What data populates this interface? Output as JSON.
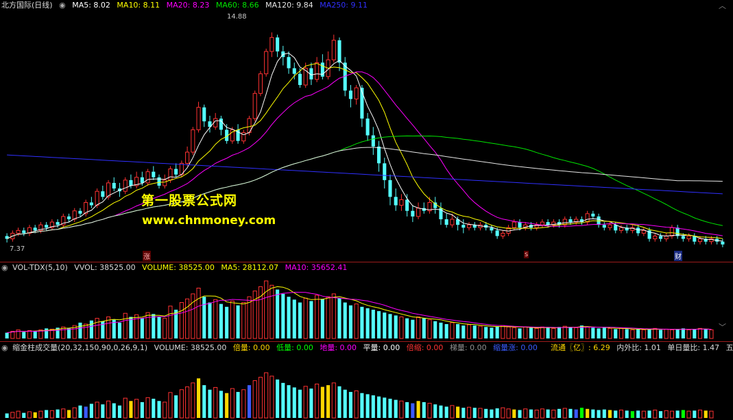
{
  "main_legend": {
    "stock_name": "北方国际(日线)",
    "ma5": "MA5: 8.02",
    "ma10": "MA10: 8.11",
    "ma20": "MA20: 8.23",
    "ma60": "MA60: 8.66",
    "ma120": "MA120: 9.84",
    "ma250": "MA250: 9.11"
  },
  "vol_legend": {
    "name": "VOL-TDX(5,10)",
    "vvol": "VVOL: 38525.00",
    "volume": "VOLUME: 38525.00",
    "ma5": "MA5: 28112.07",
    "ma10": "MA10: 35652.41"
  },
  "third_legend": {
    "name": "缩金柱成交量(20,32,150,90,0,26,9,1)",
    "volume": "VOLUME: 38525.00",
    "bei": "倍量: 0.00",
    "di": "低量: 0.00",
    "di2": "地量: 0.00",
    "ping": "平量: 0.00",
    "beisuo": "倍缩: 0.00",
    "ti": "梯量: 0.00",
    "suo": "缩量涨: 0.00",
    "liutong": "流通〖亿〗: 6.29",
    "neiwai": "内外比: 1.01",
    "danri": "单日量比: 1.47",
    "wu": "五日"
  },
  "price_labels": {
    "high": "14.88",
    "low": "7.37"
  },
  "events": {
    "zhang": "涨",
    "s": "s",
    "cai": "财"
  },
  "watermark": {
    "line1": "第一股票公式网",
    "line2": "www.chnmoney.com"
  },
  "colors": {
    "up": "#ff3232",
    "down": "#54fcfc",
    "ma5": "#ffffff",
    "ma10": "#ffff00",
    "ma20": "#ff00ff",
    "ma60": "#00e600",
    "ma120": "#e6e6e6",
    "ma250": "#3030ff",
    "gold": "#ffd700",
    "green": "#00ff00",
    "blue": "#3a5bff"
  },
  "chart_data": {
    "type": "candlestick",
    "title": "北方国际(日线)",
    "ylim": [
      7.0,
      15.5
    ],
    "high": 14.88,
    "low": 7.37,
    "candles": [
      [
        7.6,
        7.5,
        7.7,
        7.37
      ],
      [
        7.5,
        7.7,
        7.8,
        7.4
      ],
      [
        7.7,
        7.8,
        7.9,
        7.6
      ],
      [
        7.8,
        7.7,
        7.9,
        7.6
      ],
      [
        7.7,
        7.9,
        8.0,
        7.6
      ],
      [
        7.9,
        7.8,
        8.0,
        7.7
      ],
      [
        7.8,
        8.0,
        8.1,
        7.7
      ],
      [
        8.0,
        7.9,
        8.1,
        7.8
      ],
      [
        7.9,
        8.1,
        8.2,
        7.8
      ],
      [
        8.1,
        8.0,
        8.2,
        7.9
      ],
      [
        8.0,
        8.3,
        8.4,
        7.9
      ],
      [
        8.3,
        8.2,
        8.4,
        8.1
      ],
      [
        8.2,
        8.5,
        8.6,
        8.1
      ],
      [
        8.5,
        8.4,
        8.6,
        8.3
      ],
      [
        8.4,
        8.8,
        8.9,
        8.3
      ],
      [
        8.8,
        8.7,
        9.0,
        8.6
      ],
      [
        8.7,
        9.2,
        9.3,
        8.6
      ],
      [
        9.2,
        9.0,
        9.4,
        8.9
      ],
      [
        9.0,
        9.5,
        9.6,
        8.9
      ],
      [
        9.5,
        9.3,
        9.7,
        9.2
      ],
      [
        9.3,
        9.2,
        9.5,
        9.0
      ],
      [
        9.2,
        9.6,
        9.7,
        9.1
      ],
      [
        9.6,
        9.4,
        9.8,
        9.3
      ],
      [
        9.4,
        9.7,
        9.9,
        9.3
      ],
      [
        9.7,
        9.5,
        9.9,
        9.4
      ],
      [
        9.5,
        9.9,
        10.0,
        9.4
      ],
      [
        9.9,
        9.7,
        10.1,
        9.6
      ],
      [
        9.7,
        9.4,
        9.8,
        9.3
      ],
      [
        9.4,
        9.6,
        9.8,
        9.3
      ],
      [
        9.6,
        10.0,
        10.1,
        9.5
      ],
      [
        10.0,
        9.8,
        10.2,
        9.7
      ],
      [
        9.8,
        10.2,
        10.3,
        9.7
      ],
      [
        10.2,
        10.6,
        10.8,
        10.1
      ],
      [
        10.6,
        11.4,
        11.5,
        10.5
      ],
      [
        11.4,
        12.2,
        12.4,
        11.3
      ],
      [
        12.2,
        11.7,
        12.3,
        11.5
      ],
      [
        11.7,
        11.5,
        11.9,
        11.3
      ],
      [
        11.5,
        11.8,
        12.0,
        11.4
      ],
      [
        11.8,
        11.4,
        11.9,
        11.2
      ],
      [
        11.4,
        11.0,
        11.6,
        10.9
      ],
      [
        11.0,
        11.4,
        11.5,
        10.9
      ],
      [
        11.4,
        11.0,
        11.6,
        10.9
      ],
      [
        11.0,
        11.3,
        11.4,
        10.9
      ],
      [
        11.3,
        11.8,
        11.9,
        11.2
      ],
      [
        11.8,
        12.7,
        12.8,
        11.7
      ],
      [
        12.7,
        13.4,
        13.5,
        12.6
      ],
      [
        13.4,
        14.2,
        14.3,
        13.3
      ],
      [
        14.2,
        14.7,
        14.88,
        14.0
      ],
      [
        14.7,
        14.2,
        14.8,
        14.0
      ],
      [
        14.2,
        14.0,
        14.4,
        13.7
      ],
      [
        14.0,
        13.6,
        14.2,
        13.4
      ],
      [
        13.6,
        13.4,
        13.8,
        13.2
      ],
      [
        13.4,
        13.0,
        13.6,
        12.9
      ],
      [
        13.0,
        13.6,
        13.8,
        12.9
      ],
      [
        13.6,
        13.2,
        13.8,
        13.0
      ],
      [
        13.2,
        13.8,
        14.0,
        13.1
      ],
      [
        13.8,
        13.3,
        14.1,
        13.2
      ],
      [
        13.3,
        13.9,
        14.2,
        13.2
      ],
      [
        13.9,
        14.6,
        14.8,
        13.8
      ],
      [
        14.6,
        13.8,
        14.7,
        13.5
      ],
      [
        13.8,
        12.8,
        14.0,
        12.6
      ],
      [
        12.8,
        12.5,
        13.0,
        12.2
      ],
      [
        12.5,
        12.9,
        13.0,
        12.3
      ],
      [
        12.9,
        11.8,
        13.0,
        11.5
      ],
      [
        11.8,
        11.2,
        12.0,
        11.0
      ],
      [
        11.2,
        10.8,
        11.5,
        10.5
      ],
      [
        10.8,
        10.2,
        11.0,
        9.9
      ],
      [
        10.2,
        9.6,
        10.4,
        9.3
      ],
      [
        9.6,
        9.0,
        9.8,
        8.7
      ],
      [
        9.0,
        8.7,
        9.3,
        8.5
      ],
      [
        8.7,
        8.9,
        9.1,
        8.5
      ],
      [
        8.9,
        8.5,
        9.1,
        8.3
      ],
      [
        8.5,
        8.3,
        8.7,
        8.1
      ],
      [
        8.3,
        8.6,
        8.8,
        8.2
      ],
      [
        8.6,
        8.5,
        8.8,
        8.4
      ],
      [
        8.5,
        8.8,
        9.0,
        8.4
      ],
      [
        8.8,
        8.6,
        9.0,
        8.4
      ],
      [
        8.6,
        8.2,
        8.8,
        8.0
      ],
      [
        8.2,
        8.0,
        8.4,
        7.9
      ],
      [
        8.0,
        8.2,
        8.4,
        7.9
      ],
      [
        8.2,
        8.0,
        8.3,
        7.8
      ],
      [
        8.0,
        7.9,
        8.2,
        7.7
      ],
      [
        7.9,
        8.0,
        8.1,
        7.8
      ],
      [
        8.0,
        7.9,
        8.1,
        7.8
      ],
      [
        7.9,
        8.0,
        8.1,
        7.8
      ],
      [
        8.0,
        7.9,
        8.1,
        7.8
      ],
      [
        7.9,
        7.8,
        8.0,
        7.7
      ],
      [
        7.8,
        7.6,
        7.9,
        7.5
      ],
      [
        7.6,
        7.7,
        7.8,
        7.5
      ],
      [
        7.7,
        7.9,
        8.0,
        7.6
      ],
      [
        7.9,
        8.1,
        8.2,
        7.8
      ],
      [
        8.1,
        7.9,
        8.2,
        7.8
      ],
      [
        7.9,
        8.0,
        8.1,
        7.8
      ],
      [
        8.0,
        7.9,
        8.1,
        7.8
      ],
      [
        7.9,
        8.0,
        8.1,
        7.8
      ],
      [
        8.0,
        8.1,
        8.2,
        7.9
      ],
      [
        8.1,
        8.0,
        8.2,
        7.9
      ],
      [
        8.0,
        8.1,
        8.2,
        7.9
      ],
      [
        8.1,
        8.0,
        8.2,
        7.9
      ],
      [
        8.0,
        8.2,
        8.3,
        7.9
      ],
      [
        8.2,
        8.1,
        8.3,
        8.0
      ],
      [
        8.1,
        8.2,
        8.3,
        8.0
      ],
      [
        8.2,
        8.1,
        8.3,
        8.0
      ],
      [
        8.1,
        8.4,
        8.5,
        8.0
      ],
      [
        8.4,
        8.3,
        8.5,
        8.2
      ],
      [
        8.3,
        8.0,
        8.4,
        7.9
      ],
      [
        8.0,
        7.9,
        8.1,
        7.8
      ],
      [
        7.9,
        8.0,
        8.1,
        7.8
      ],
      [
        8.0,
        7.8,
        8.1,
        7.7
      ],
      [
        7.8,
        7.9,
        8.0,
        7.7
      ],
      [
        7.9,
        7.8,
        8.0,
        7.7
      ],
      [
        7.8,
        7.9,
        8.0,
        7.7
      ],
      [
        7.9,
        7.7,
        8.0,
        7.6
      ],
      [
        7.7,
        7.8,
        7.9,
        7.6
      ],
      [
        7.8,
        7.5,
        7.9,
        7.4
      ],
      [
        7.5,
        7.6,
        7.7,
        7.4
      ],
      [
        7.6,
        7.5,
        7.7,
        7.4
      ],
      [
        7.5,
        7.6,
        7.7,
        7.4
      ],
      [
        7.6,
        7.9,
        8.0,
        7.5
      ],
      [
        7.9,
        7.6,
        8.0,
        7.5
      ],
      [
        7.6,
        7.5,
        7.7,
        7.4
      ],
      [
        7.5,
        7.6,
        7.7,
        7.4
      ],
      [
        7.6,
        7.4,
        7.7,
        7.3
      ],
      [
        7.4,
        7.5,
        7.6,
        7.3
      ],
      [
        7.5,
        7.4,
        7.6,
        7.3
      ],
      [
        7.4,
        7.5,
        7.6,
        7.3
      ],
      [
        7.5,
        7.4,
        7.6,
        7.3
      ],
      [
        7.4,
        7.3,
        7.5,
        7.2
      ]
    ],
    "volume": [
      8,
      10,
      12,
      9,
      11,
      10,
      12,
      14,
      13,
      15,
      16,
      14,
      18,
      22,
      20,
      25,
      28,
      24,
      30,
      26,
      22,
      35,
      30,
      33,
      28,
      36,
      34,
      30,
      28,
      45,
      40,
      50,
      55,
      62,
      70,
      58,
      50,
      54,
      48,
      44,
      52,
      46,
      50,
      58,
      66,
      72,
      80,
      74,
      68,
      62,
      58,
      54,
      50,
      56,
      52,
      60,
      55,
      58,
      62,
      56,
      50,
      46,
      48,
      44,
      42,
      40,
      38,
      36,
      34,
      32,
      30,
      28,
      26,
      30,
      28,
      26,
      24,
      22,
      20,
      22,
      20,
      18,
      19,
      18,
      17,
      16,
      15,
      17,
      18,
      16,
      15,
      14,
      16,
      15,
      14,
      16,
      15,
      14,
      16,
      17,
      16,
      15,
      18,
      16,
      15,
      14,
      15,
      14,
      13,
      14,
      13,
      12,
      13,
      12,
      13,
      14,
      12,
      13,
      12,
      13,
      14,
      12,
      13,
      14,
      13,
      12
    ],
    "volume_ma5_label": "MA5: 28112.07",
    "volume_ma10_label": "MA10: 35652.41"
  }
}
